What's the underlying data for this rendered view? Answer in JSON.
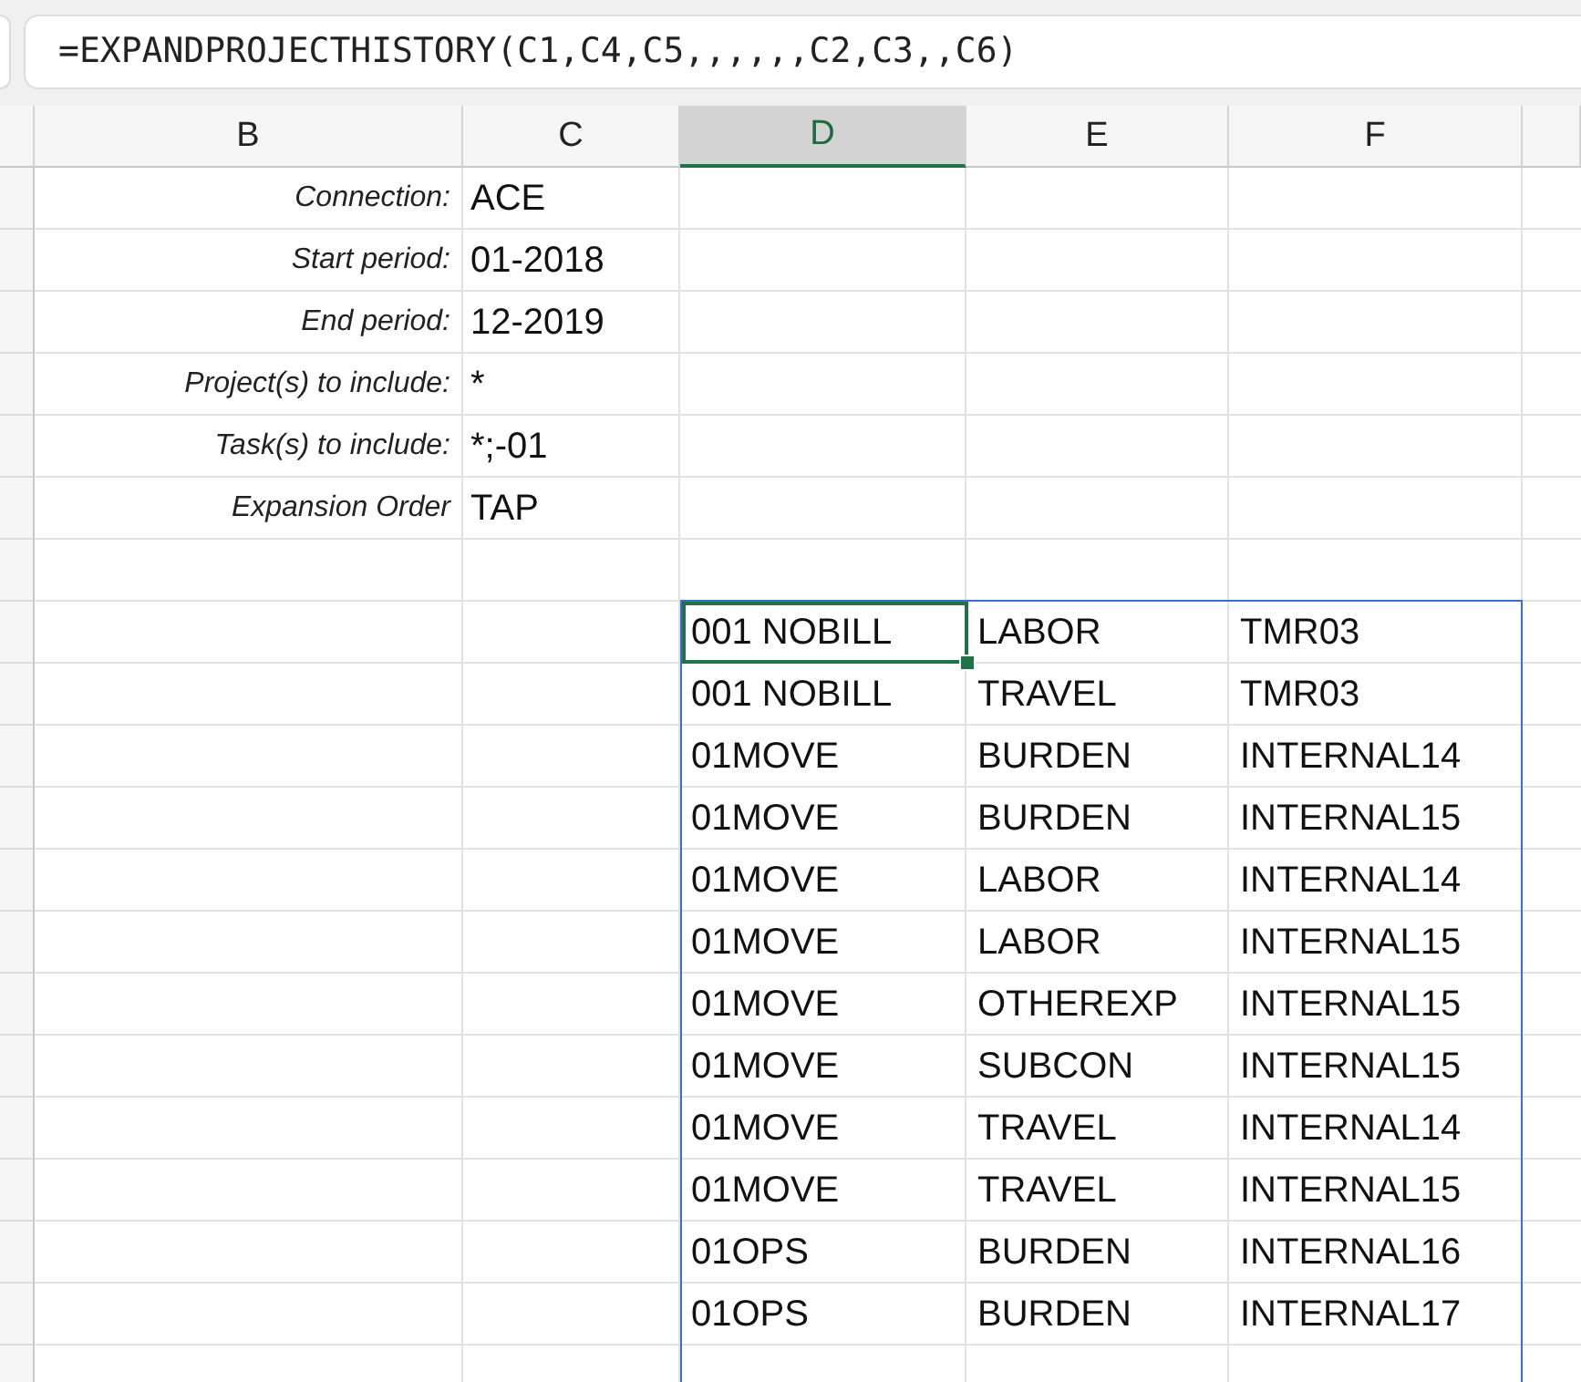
{
  "formula_bar": {
    "value": "=EXPANDPROJECTHISTORY(C1,C4,C5,,,,,,C2,C3,,C6)"
  },
  "columns": [
    {
      "label": "B",
      "selected": false
    },
    {
      "label": "C",
      "selected": false
    },
    {
      "label": "D",
      "selected": true
    },
    {
      "label": "E",
      "selected": false
    },
    {
      "label": "F",
      "selected": false
    }
  ],
  "parameters": [
    {
      "label": "Connection:",
      "value": "ACE"
    },
    {
      "label": "Start period:",
      "value": "01-2018"
    },
    {
      "label": "End period:",
      "value": "12-2019"
    },
    {
      "label": "Project(s) to include:",
      "value": "*"
    },
    {
      "label": "Task(s) to include:",
      "value": "*;-01"
    },
    {
      "label": "Expansion Order",
      "value": "TAP"
    }
  ],
  "results": [
    {
      "project": "001 NOBILL",
      "task": "LABOR",
      "code": "TMR03",
      "selected": true
    },
    {
      "project": "001 NOBILL",
      "task": "TRAVEL",
      "code": "TMR03",
      "selected": false
    },
    {
      "project": "01MOVE",
      "task": "BURDEN",
      "code": "INTERNAL14",
      "selected": false
    },
    {
      "project": "01MOVE",
      "task": "BURDEN",
      "code": "INTERNAL15",
      "selected": false
    },
    {
      "project": "01MOVE",
      "task": "LABOR",
      "code": "INTERNAL14",
      "selected": false
    },
    {
      "project": "01MOVE",
      "task": "LABOR",
      "code": "INTERNAL15",
      "selected": false
    },
    {
      "project": "01MOVE",
      "task": "OTHEREXP",
      "code": "INTERNAL15",
      "selected": false
    },
    {
      "project": "01MOVE",
      "task": "SUBCON",
      "code": "INTERNAL15",
      "selected": false
    },
    {
      "project": "01MOVE",
      "task": "TRAVEL",
      "code": "INTERNAL14",
      "selected": false
    },
    {
      "project": "01MOVE",
      "task": "TRAVEL",
      "code": "INTERNAL15",
      "selected": false
    },
    {
      "project": "01OPS",
      "task": "BURDEN",
      "code": "INTERNAL16",
      "selected": false
    },
    {
      "project": "01OPS",
      "task": "BURDEN",
      "code": "INTERNAL17",
      "selected": false
    }
  ]
}
